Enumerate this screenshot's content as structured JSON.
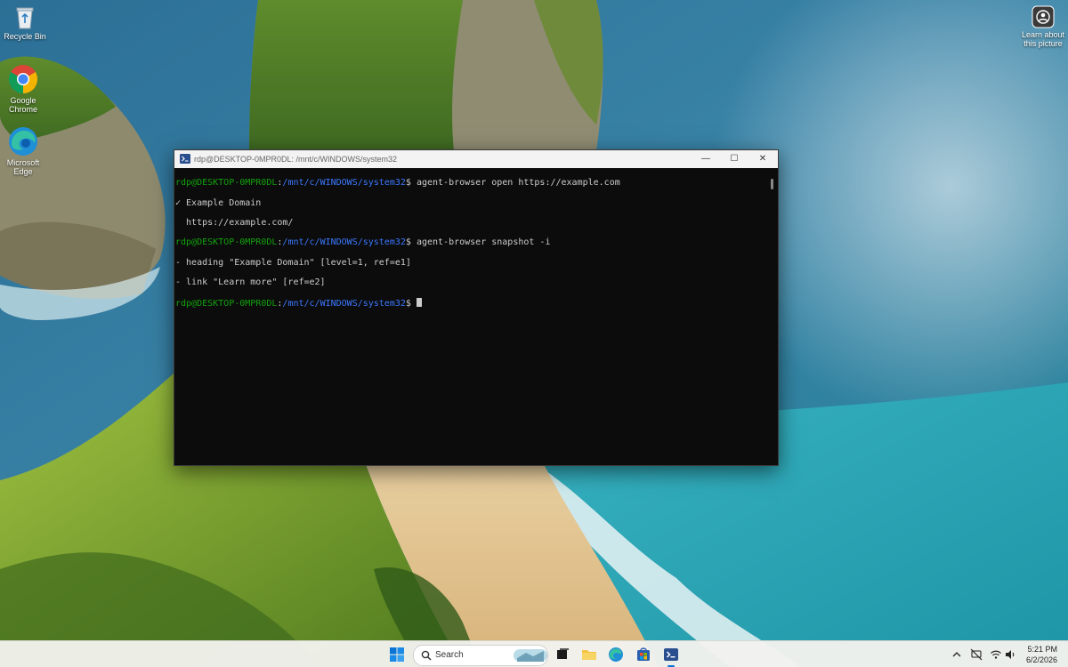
{
  "desktop": {
    "icons": [
      {
        "label": "Recycle Bin",
        "icon": "recycle-bin-icon"
      },
      {
        "label": "Google Chrome",
        "icon": "chrome-icon"
      },
      {
        "label": "Microsoft Edge",
        "icon": "edge-icon"
      }
    ],
    "spotlight_label": "Learn about this picture"
  },
  "terminal": {
    "title": "rdp@DESKTOP-0MPR0DL: /mnt/c/WINDOWS/system32",
    "prompt_user": "rdp@DESKTOP-0MPR0DL",
    "prompt_path": "/mnt/c/WINDOWS/system32",
    "commands": {
      "cmd1": "agent-browser open https://example.com",
      "out1a": "✓ Example Domain",
      "out1b": "  https://example.com/",
      "cmd2": "agent-browser snapshot -i",
      "out2a": "- heading \"Example Domain\" [level=1, ref=e1]",
      "out2b": "- link \"Learn more\" [ref=e2]"
    },
    "window_buttons": {
      "minimize": "—",
      "maximize": "☐",
      "close": "✕"
    }
  },
  "taskbar": {
    "search_placeholder": "Search",
    "pinned": [
      "windows-start-icon",
      "search-icon",
      "task-view-icon",
      "file-explorer-icon",
      "edge-icon",
      "store-icon",
      "terminal-icon"
    ],
    "tray_icons": [
      "chevron-up-icon",
      "network-offline-icon",
      "wifi-icon",
      "volume-icon"
    ],
    "time": "5:21 PM",
    "date": "6/2/2026"
  },
  "colors": {
    "prompt_user": "#13a10e",
    "prompt_path": "#3b78ff",
    "terminal_bg": "#0c0c0c",
    "terminal_text": "#cccccc"
  }
}
